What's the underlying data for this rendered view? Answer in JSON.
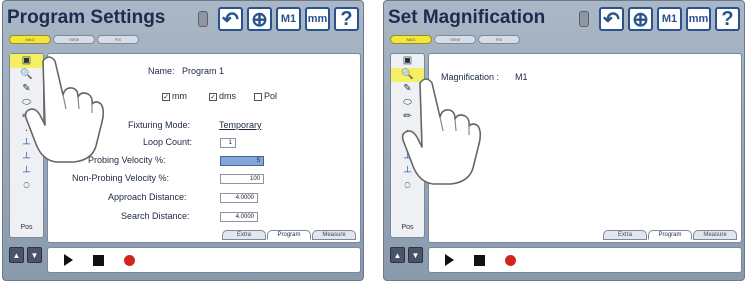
{
  "left": {
    "title": "Program Settings",
    "top_tabs": [
      "MAG",
      "VIEW",
      "FIX"
    ],
    "head_buttons": {
      "undo": "↶",
      "target": "⊕",
      "mode": "M1",
      "units": "mm",
      "help": "?"
    },
    "sidebar": {
      "items": [
        "▣",
        "🔍",
        "✎",
        "⬭",
        "✏",
        "·",
        "┴",
        "┴",
        "┴",
        "⍥"
      ],
      "pos": "Pos",
      "count_side": "3"
    },
    "fields": {
      "name_label": "Name:",
      "name_value": "Program 1",
      "mm": "mm",
      "dms": "dms",
      "pol": "Pol",
      "fixture_label": "Fixturing Mode:",
      "fixture_value": "Temporary",
      "loop_label": "Loop Count:",
      "loop_value": "1",
      "probe_label": "Probing Velocity %:",
      "probe_value": "5",
      "nonprobe_label": "Non-Probing Velocity %:",
      "nonprobe_value": "100",
      "approach_label": "Approach Distance:",
      "approach_value": "4.0000",
      "search_label": "Search Distance:",
      "search_value": "4.0000"
    },
    "bottom_tabs": [
      "Extra",
      "Program",
      "Measure"
    ],
    "active_bottom_tab": "Program"
  },
  "right": {
    "title": "Set Magnification",
    "top_tabs": [
      "MAG",
      "VIEW",
      "FIX"
    ],
    "head_buttons": {
      "undo": "↶",
      "target": "⊕",
      "mode": "M1",
      "units": "mm",
      "help": "?"
    },
    "sidebar": {
      "items": [
        "▣",
        "🔍",
        "✎",
        "⬭",
        "✏",
        "·",
        "┴",
        "┴",
        "┴",
        "⍥"
      ],
      "pos": "Pos"
    },
    "magnification_label": "Magnification :",
    "magnification_value": "M1",
    "bottom_tabs": [
      "Extra",
      "Program",
      "Measure"
    ],
    "active_bottom_tab": "Program"
  },
  "arrows": {
    "up": "▲",
    "down": "▼"
  }
}
